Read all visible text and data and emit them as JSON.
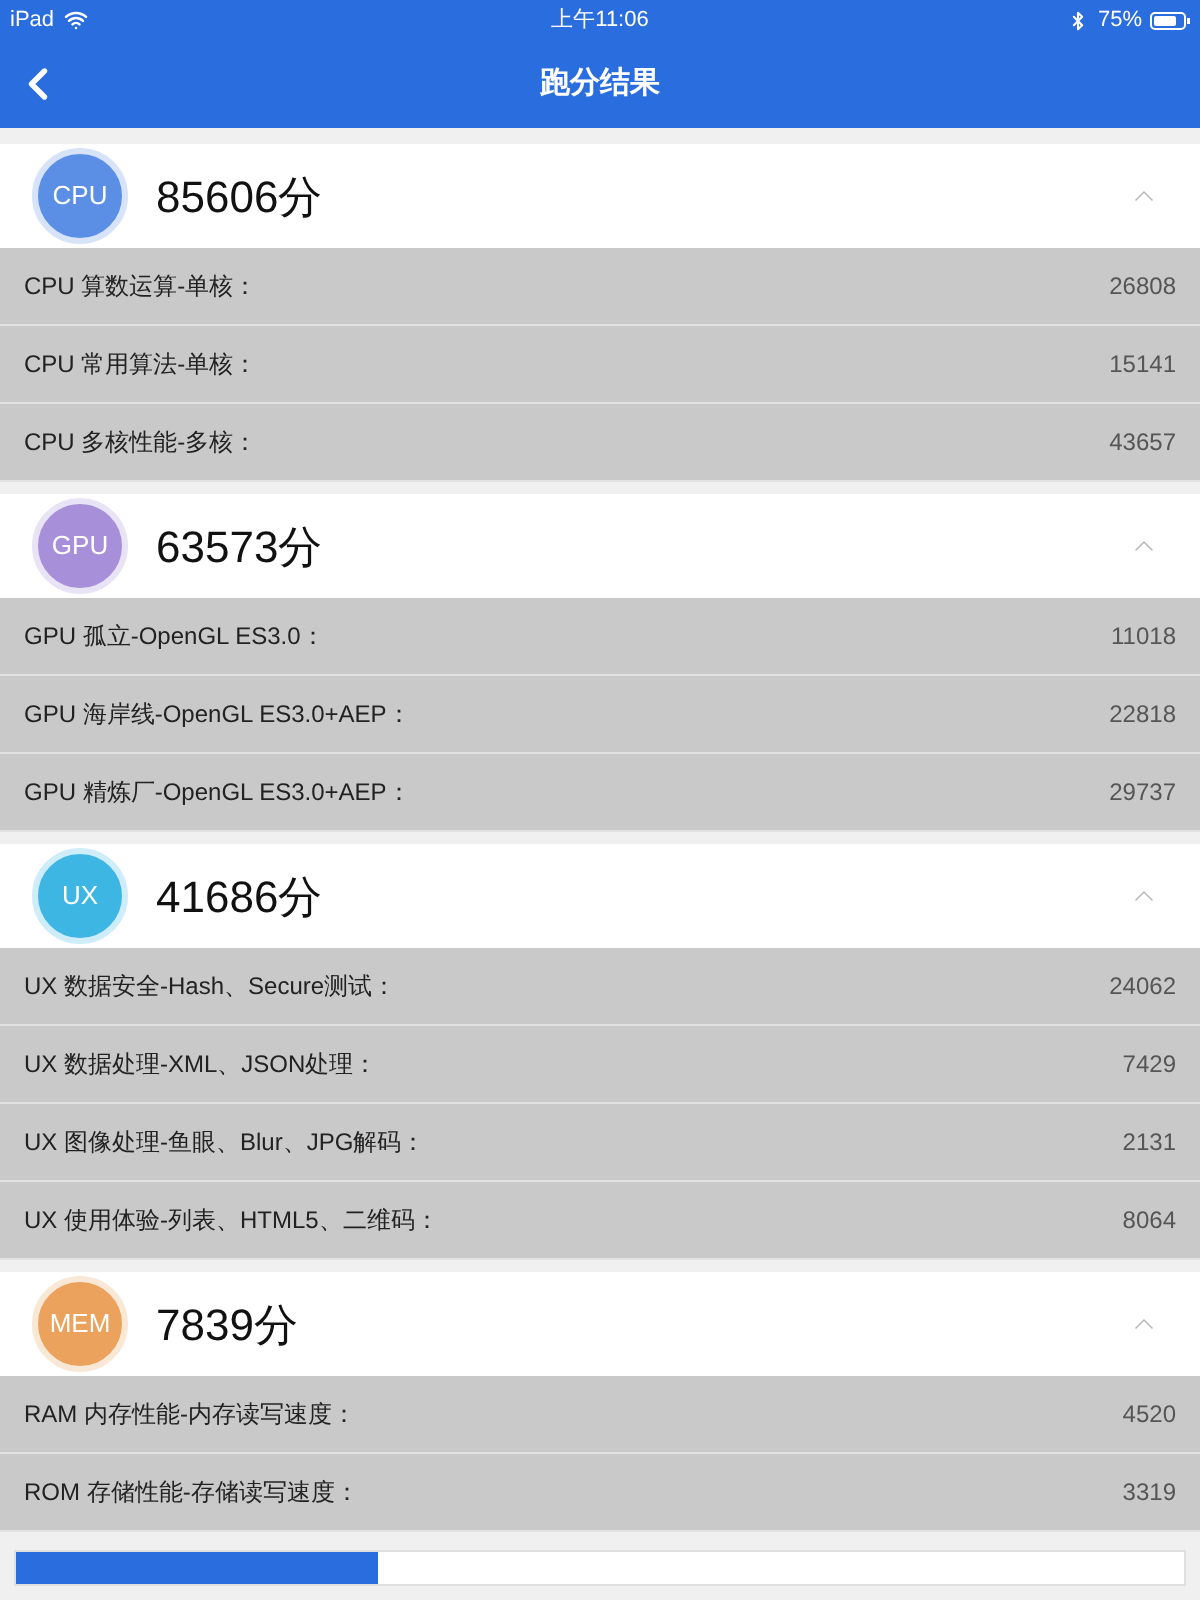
{
  "status_bar": {
    "device": "iPad",
    "time": "上午11:06",
    "battery": "75%"
  },
  "nav": {
    "title": "跑分结果"
  },
  "sections": [
    {
      "badge": "CPU",
      "color": "#5b8fe6",
      "score": "85606分",
      "expanded": true,
      "rows": [
        {
          "label": "CPU 算数运算-单核：",
          "value": "26808"
        },
        {
          "label": "CPU 常用算法-单核：",
          "value": "15141"
        },
        {
          "label": "CPU 多核性能-多核：",
          "value": "43657"
        }
      ]
    },
    {
      "badge": "GPU",
      "color": "#a78fd9",
      "score": "63573分",
      "expanded": true,
      "rows": [
        {
          "label": "GPU 孤立-OpenGL ES3.0：",
          "value": "11018"
        },
        {
          "label": "GPU 海岸线-OpenGL ES3.0+AEP：",
          "value": "22818"
        },
        {
          "label": "GPU 精炼厂-OpenGL ES3.0+AEP：",
          "value": "29737"
        }
      ]
    },
    {
      "badge": "UX",
      "color": "#3db6e3",
      "score": "41686分",
      "expanded": true,
      "rows": [
        {
          "label": "UX 数据安全-Hash、Secure测试：",
          "value": "24062"
        },
        {
          "label": "UX 数据处理-XML、JSON处理：",
          "value": "7429"
        },
        {
          "label": "UX 图像处理-鱼眼、Blur、JPG解码：",
          "value": "2131"
        },
        {
          "label": "UX 使用体验-列表、HTML5、二维码：",
          "value": "8064"
        }
      ]
    },
    {
      "badge": "MEM",
      "color": "#eba25c",
      "score": "7839分",
      "expanded": true,
      "rows": [
        {
          "label": "RAM 内存性能-内存读写速度：",
          "value": "4520"
        },
        {
          "label": "ROM 存储性能-存储读写速度：",
          "value": "3319"
        }
      ]
    }
  ],
  "bottom_bar": {
    "level": 0.31
  }
}
